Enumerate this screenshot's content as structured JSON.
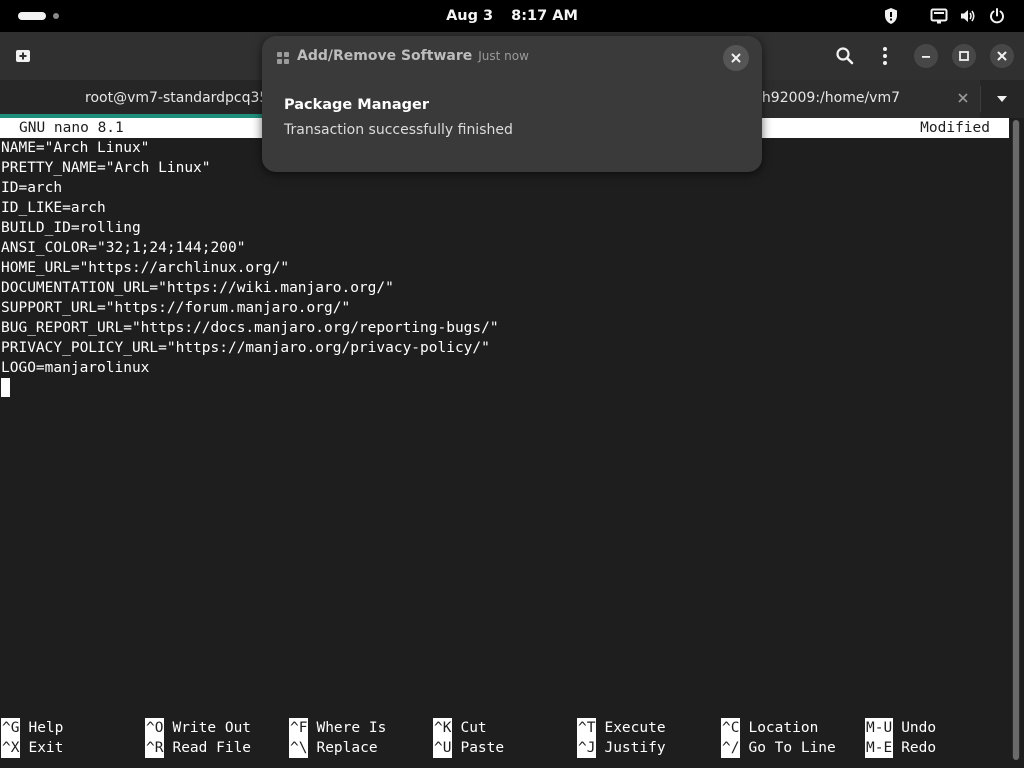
{
  "topbar": {
    "date": "Aug 3",
    "time": "8:17 AM",
    "icons": [
      "activities-indicator",
      "privacy-shield-icon",
      "network-icon",
      "volume-icon",
      "power-icon"
    ]
  },
  "titlebar": {
    "icons": [
      "new-tab-icon",
      "search-icon",
      "menu-kebab-icon",
      "minimize-icon",
      "maximize-icon",
      "close-icon"
    ]
  },
  "tabs": [
    {
      "label": "root@vm7-standardpcq35",
      "active": true
    },
    {
      "label": "ch92009:/home/vm7",
      "active": false
    }
  ],
  "nano": {
    "title": "GNU nano 8.1",
    "status": "Modified",
    "lines": [
      "NAME=\"Arch Linux\"",
      "PRETTY_NAME=\"Arch Linux\"",
      "ID=arch",
      "ID_LIKE=arch",
      "BUILD_ID=rolling",
      "ANSI_COLOR=\"32;1;24;144;200\"",
      "HOME_URL=\"https://archlinux.org/\"",
      "DOCUMENTATION_URL=\"https://wiki.manjaro.org/\"",
      "SUPPORT_URL=\"https://forum.manjaro.org/\"",
      "BUG_REPORT_URL=\"https://docs.manjaro.org/reporting-bugs/\"",
      "PRIVACY_POLICY_URL=\"https://manjaro.org/privacy-policy/\"",
      "LOGO=manjarolinux"
    ],
    "shortcuts": [
      {
        "key": "^G",
        "label": "Help"
      },
      {
        "key": "^X",
        "label": "Exit"
      },
      {
        "key": "^O",
        "label": "Write Out"
      },
      {
        "key": "^R",
        "label": "Read File"
      },
      {
        "key": "^F",
        "label": "Where Is"
      },
      {
        "key": "^\\",
        "label": "Replace"
      },
      {
        "key": "^K",
        "label": "Cut"
      },
      {
        "key": "^U",
        "label": "Paste"
      },
      {
        "key": "^T",
        "label": "Execute"
      },
      {
        "key": "^J",
        "label": "Justify"
      },
      {
        "key": "^C",
        "label": "Location"
      },
      {
        "key": "^/",
        "label": "Go To Line"
      },
      {
        "key": "M-U",
        "label": "Undo"
      },
      {
        "key": "M-E",
        "label": "Redo"
      }
    ]
  },
  "notification": {
    "app": "Add/Remove Software",
    "time": "Just now",
    "title": "Package Manager",
    "body": "Transaction successfully finished"
  },
  "colors": {
    "background": "#1e1e1e",
    "topbar": "#000000",
    "titlebar": "#303030",
    "tab_accent": "#1f8e7b",
    "notification": "#3a3a3a"
  }
}
